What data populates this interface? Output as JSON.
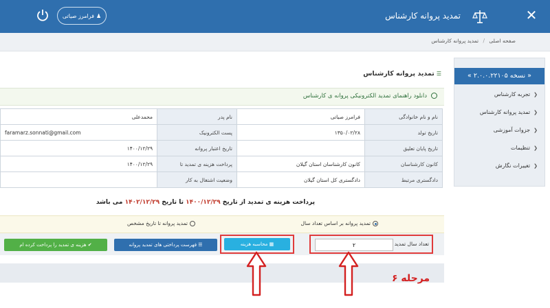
{
  "header": {
    "title": "تمدید پروانه کارشناس",
    "close_icon": "close-icon",
    "user_name": "فرامرز صیاتی",
    "power_icon": "power-icon"
  },
  "breadcrumb": {
    "home": "صفحه اصلی",
    "current": "تمدید پروانه کارشناس"
  },
  "sidebar": {
    "version": "« نسخه ۲.۰.۰.۲۲۱۰۵ »",
    "items": [
      {
        "label": "تجربه کارشناس"
      },
      {
        "label": "تمدید پروانه کارشناس"
      },
      {
        "label": "جزوات آموزشی"
      },
      {
        "label": "تنظیمات"
      },
      {
        "label": "تغییرات نگارش"
      }
    ]
  },
  "main": {
    "page_title": "تمدید پروانه کارشناس",
    "guide_link": "دانلود راهنمای تمدید الکترونیکی پروانه ی کارشناس",
    "info_rows": [
      {
        "l1": "نام و نام خانوادگی",
        "v1": "فرامرز صیاتی",
        "l2": "نام پدر",
        "v2": "محمدعلی"
      },
      {
        "l1": "تاریخ تولد",
        "v1": "۱۳۵۰/۰۲/۲۸",
        "l2": "پست الکترونیک",
        "v2": "faramarz.sonnati@gmail.com"
      },
      {
        "l1": "تاریخ پایان تعلیق",
        "v1": "",
        "l2": "تاریخ اعتبار پروانه",
        "v2": "۱۴۰۰/۱۲/۲۹"
      },
      {
        "l1": "کانون کارشناسان",
        "v1": "کانون کارشناسان استان گیلان",
        "l2": "پرداخت هزینه ی تمدید تا",
        "v2": "۱۴۰۰/۱۲/۲۹"
      },
      {
        "l1": "دادگستری مرتبط",
        "v1": "دادگستری کل استان گیلان",
        "l2": "وضعیت اشتغال به کار",
        "v2": ""
      }
    ],
    "payment": {
      "prefix": "پرداخت هزینه ی تمدید از تاریخ",
      "from": "۱۴۰۰/۱۲/۲۹",
      "mid": "تا تاریخ",
      "to": "۱۴۰۲/۱۲/۲۹",
      "suffix": "می باشد"
    },
    "radios": {
      "by_years": "تمدید پروانه بر اساس تعداد سال",
      "by_date": "تمدید پروانه تا تاریخ مشخص"
    },
    "years_label": "تعداد سال تمدید",
    "years_value": "۲",
    "btn_calc": "محاسبه هزینه",
    "btn_list": "فهرست پرداختی های تمدید پروانه",
    "btn_pay": "هزینه ی تمدید را پرداخت کرده ام"
  },
  "annotation": {
    "step_label": "مرحله ۶"
  },
  "colors": {
    "primary": "#2f6fae",
    "calc_button": "#29b0e0",
    "pay_button": "#52b047",
    "highlight": "#e03a3a"
  }
}
